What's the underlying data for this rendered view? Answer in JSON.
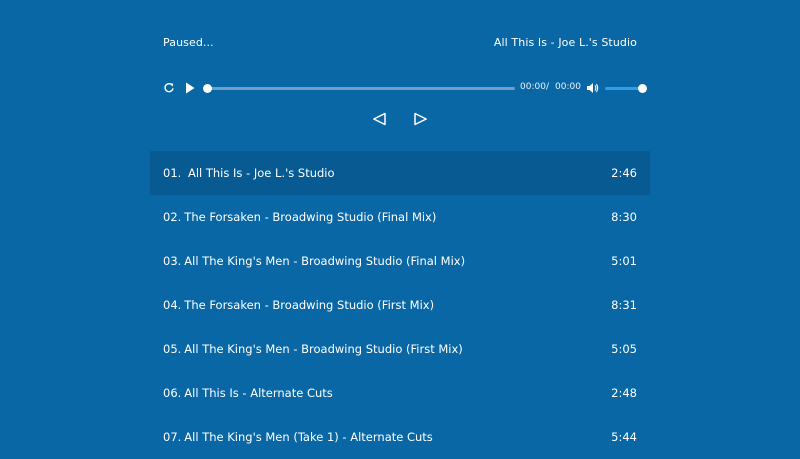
{
  "player": {
    "status": "Paused...",
    "now_playing": "All This Is - Joe L.'s Studio",
    "current_time": "00:00",
    "separator": "/",
    "duration": "00:00",
    "progress": 0.0,
    "volume": 1.0,
    "icons": {
      "repeat": "repeat-icon",
      "play": "play-icon",
      "volume": "volume-icon",
      "prev": "previous-track-icon",
      "next": "next-track-icon"
    }
  },
  "tracks": [
    {
      "num": "01.",
      "title": "All This Is - Joe L.'s Studio",
      "duration": "2:46",
      "active": true
    },
    {
      "num": "02.",
      "title": "The Forsaken - Broadwing Studio (Final Mix)",
      "duration": "8:30"
    },
    {
      "num": "03.",
      "title": "All The King's Men - Broadwing Studio (Final Mix)",
      "duration": "5:01"
    },
    {
      "num": "04.",
      "title": "The Forsaken - Broadwing Studio (First Mix)",
      "duration": "8:31"
    },
    {
      "num": "05.",
      "title": "All The King's Men - Broadwing Studio (First Mix)",
      "duration": "5:05"
    },
    {
      "num": "06.",
      "title": "All This Is - Alternate Cuts",
      "duration": "2:48"
    },
    {
      "num": "07.",
      "title": "All The King's Men (Take 1) - Alternate Cuts",
      "duration": "5:44"
    }
  ],
  "colors": {
    "background": "#0967a6",
    "active_row": "#075a92",
    "seek_track": "#6f9fc6",
    "volume_fill": "#2a9ff0",
    "text": "#ffffff"
  }
}
